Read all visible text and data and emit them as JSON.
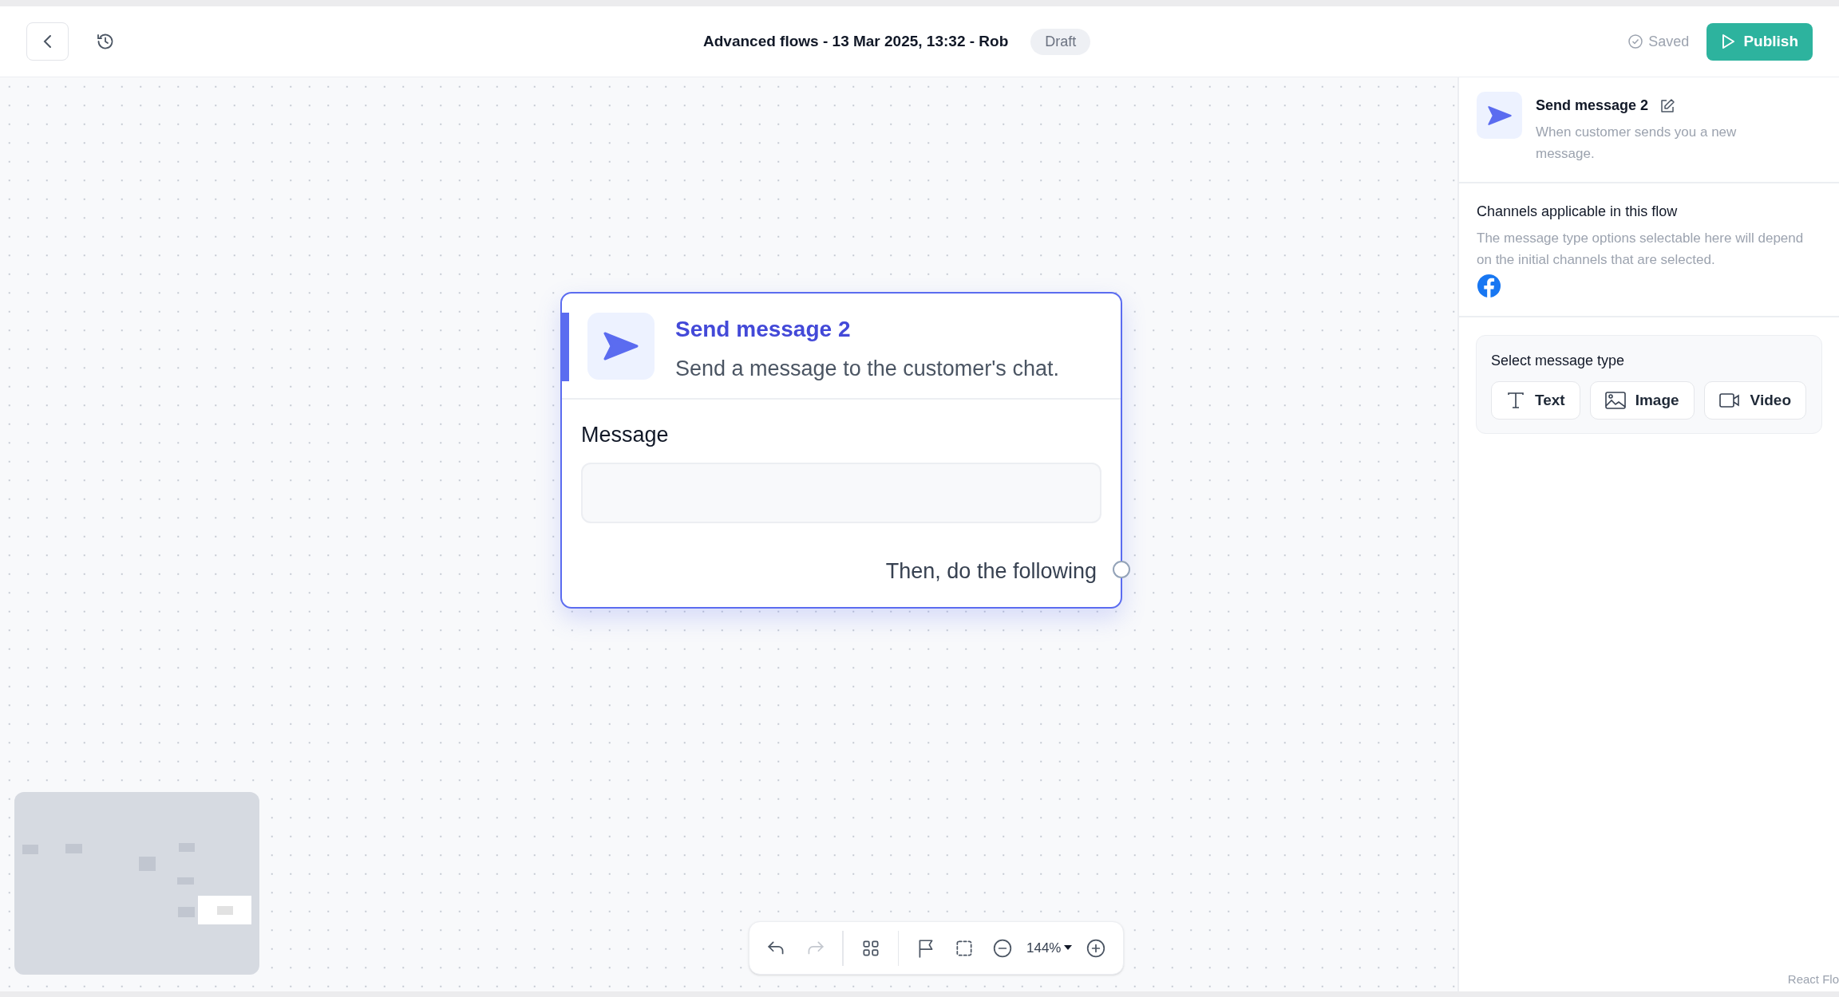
{
  "header": {
    "title": "Advanced flows - 13 Mar 2025, 13:32 - Rob",
    "badge": "Draft",
    "saved": "Saved",
    "publish": "Publish"
  },
  "node": {
    "title": "Send message 2",
    "subtitle": "Send a message to the customer's chat.",
    "selected": true,
    "field_label": "Message",
    "output_label": "Then, do the following"
  },
  "panel": {
    "title": "Send message 2",
    "description": "When customer sends you a new message.",
    "channels_title": "Channels applicable in this flow",
    "channels_description": "The message type options selectable here will depend on the initial channels that are selected.",
    "message_type_title": "Select message type",
    "message_types": [
      {
        "kind": "text",
        "label": "Text"
      },
      {
        "kind": "image",
        "label": "Image"
      },
      {
        "kind": "video",
        "label": "Video"
      }
    ]
  },
  "toolbar": {
    "tools": [
      {
        "kind": "undo",
        "disabled": false
      },
      {
        "kind": "redo",
        "disabled": true
      },
      {
        "kind": "divider"
      },
      {
        "kind": "layout",
        "disabled": false
      },
      {
        "kind": "divider"
      },
      {
        "kind": "flag",
        "disabled": false
      },
      {
        "kind": "select",
        "disabled": false
      },
      {
        "kind": "zoom-out",
        "disabled": false
      },
      {
        "kind": "zoom",
        "label": "144%"
      },
      {
        "kind": "zoom-in",
        "disabled": false
      }
    ]
  },
  "attribution": "React Flo"
}
